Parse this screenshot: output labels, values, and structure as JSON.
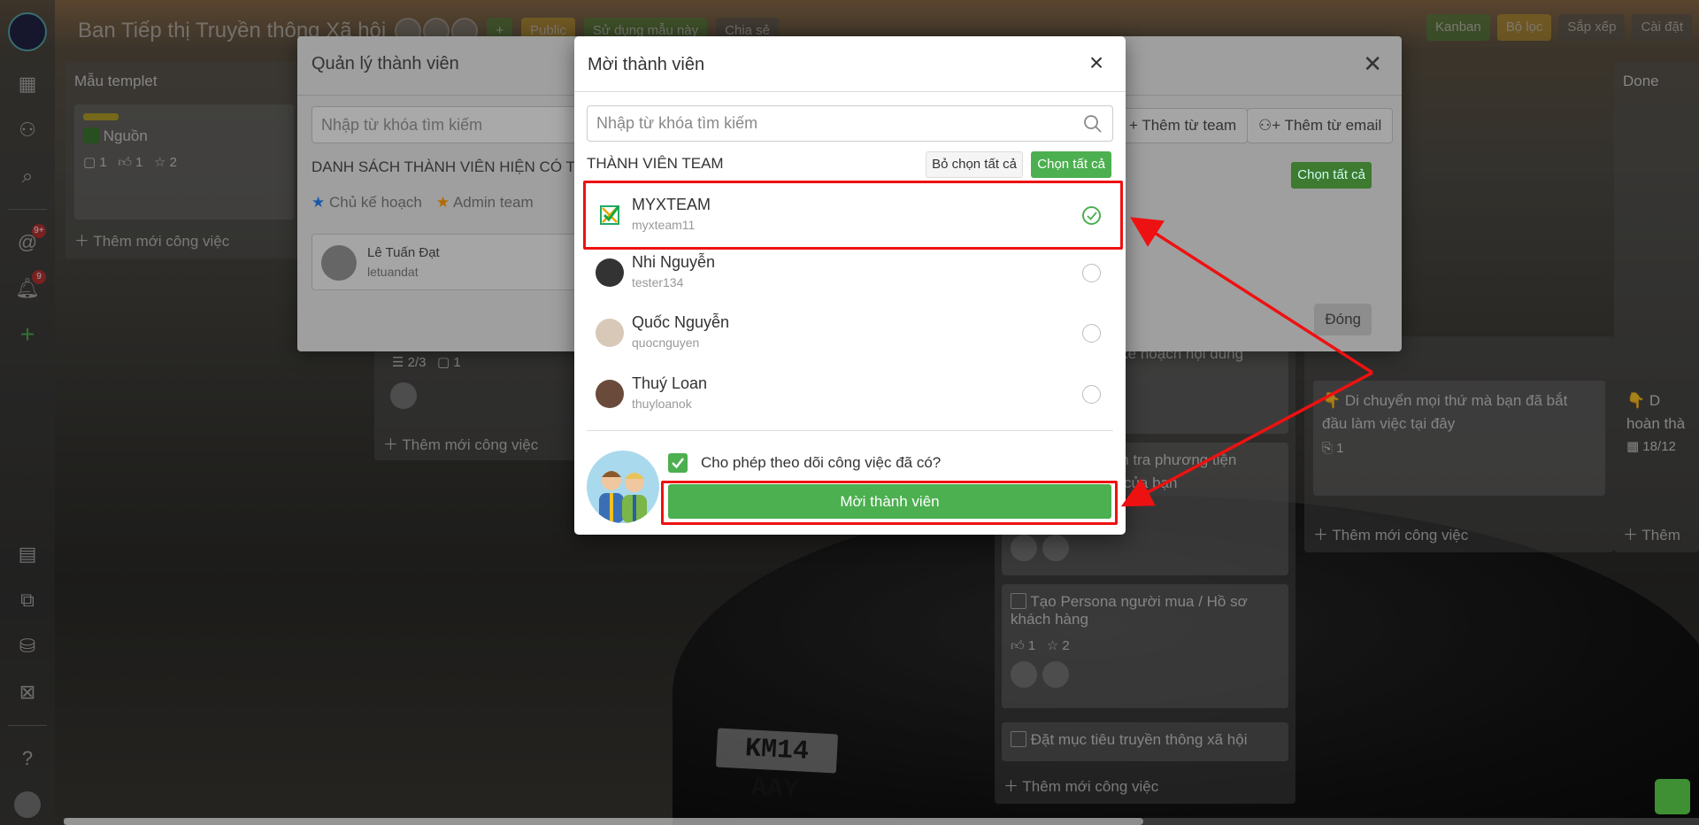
{
  "board": {
    "title": "Ban Tiếp thị Truyền thông Xã hội",
    "public_label": "Public",
    "use_template_label": "Sử dụng mẫu này",
    "share_label": "Chia sẻ",
    "kanban_label": "Kanban",
    "filter_label": "Bộ lọc",
    "sort_label": "Sắp xếp",
    "settings_label": "Cài đặt"
  },
  "sidebar": {
    "badge1": "9+",
    "badge2": "9"
  },
  "columns": {
    "template": {
      "header": "Mẫu templet",
      "card_title": "Nguồn",
      "comments": "1",
      "likes": "1",
      "stars": "2",
      "add": "Thêm mới công việc"
    },
    "col2": {
      "subtasks": "2/3",
      "comments": "1",
      "add": "Thêm mới công việc"
    },
    "col3": {
      "card1": "n kế hoạch nội dung",
      "card2a": "ểm tra phương tiện",
      "card2b": "ội của bạn",
      "card3": "Tạo Persona người mua / Hồ sơ khách hàng",
      "card3_likes": "1",
      "card3_stars": "2",
      "card4": "Đặt mục tiêu truyền thông xã hội",
      "add": "Thêm mới công việc"
    },
    "col4": {
      "card": "👇 Di chuyển mọi thứ mà bạn đã bắt đầu làm việc tại đây",
      "attach": "1",
      "add": "Thêm mới công việc"
    },
    "done": {
      "header": "Done",
      "card_a": "👇 D",
      "card_b": "hoàn thà",
      "date": "18/12",
      "add": "Thêm"
    }
  },
  "manager_modal": {
    "title": "Quản lý thành viên",
    "search_placeholder": "Nhập từ khóa tìm kiếm",
    "list_header": "DANH SÁCH THÀNH VIÊN HIỆN CÓ TR",
    "role1": "Chủ kế hoạch",
    "role2": "Admin team",
    "member_name": "Lê Tuấn Đạt",
    "member_user": "letuandat",
    "add_from_team": "Thêm từ team",
    "add_from_email": "Thêm từ email",
    "select_all": "Chọn tất cả",
    "close": "Đóng"
  },
  "invite_modal": {
    "title": "Mời thành viên",
    "search_placeholder": "Nhập từ khóa tìm kiếm",
    "section": "THÀNH VIÊN TEAM",
    "deselect_all": "Bỏ chọn tất cả",
    "select_all": "Chọn tất cả",
    "members": [
      {
        "name": "MYXTEAM",
        "username": "myxteam11",
        "selected": true
      },
      {
        "name": "Nhi Nguyễn",
        "username": "tester134",
        "selected": false
      },
      {
        "name": "Quốc Nguyễn",
        "username": "quocnguyen",
        "selected": false
      },
      {
        "name": "Thuý Loan",
        "username": "thuyloanok",
        "selected": false
      }
    ],
    "follow_label": "Cho phép theo dõi công việc đã có?",
    "follow_checked": true,
    "invite_button": "Mời thành viên"
  },
  "colors": {
    "green": "#4caf50",
    "annotation_red": "#ee1111"
  },
  "plate_text": "KM14 AAY"
}
